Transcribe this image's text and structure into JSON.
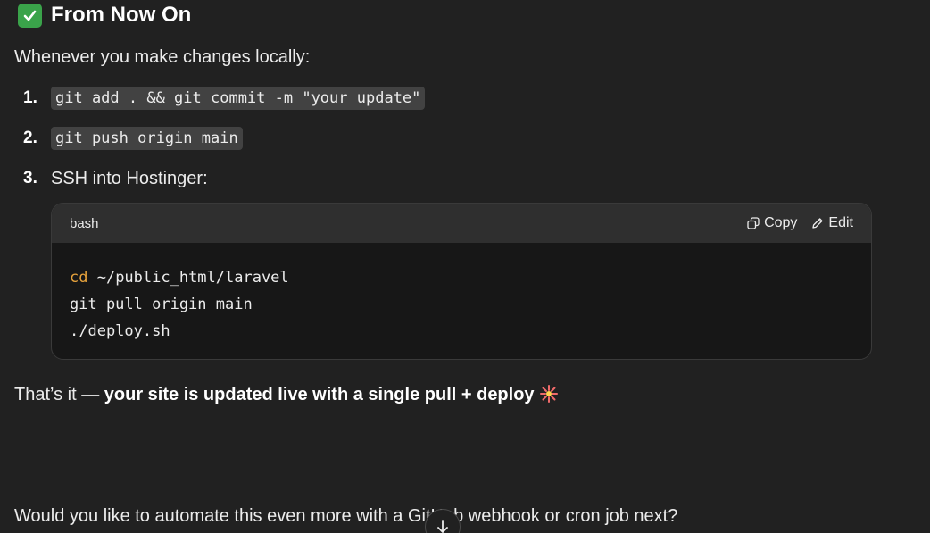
{
  "heading": {
    "icon": "check-mark-icon",
    "text": "From Now On",
    "icon_color": "#3aa34a"
  },
  "intro": "Whenever you make changes locally:",
  "steps": [
    {
      "number": "1.",
      "code": "git add . && git commit -m \"your update\""
    },
    {
      "number": "2.",
      "code": "git push origin main"
    },
    {
      "number": "3.",
      "text": "SSH into Hostinger:"
    }
  ],
  "code_block": {
    "language": "bash",
    "copy_label": "Copy",
    "edit_label": "Edit",
    "lines": [
      {
        "keyword": "cd",
        "rest": " ~/public_html/laravel"
      },
      {
        "keyword": "",
        "rest": "git pull origin main"
      },
      {
        "keyword": "",
        "rest": "./deploy.sh"
      }
    ],
    "keyword_color": "#e6a23c"
  },
  "summary": {
    "lead": "That’s it — ",
    "bold": "your site is updated live with a single pull + deploy",
    "icon": "sparkle-burst-icon"
  },
  "question": "Would you like to automate this even more with a GitHub webhook or cron job next?",
  "scroll_button": {
    "icon": "arrow-down-icon"
  }
}
